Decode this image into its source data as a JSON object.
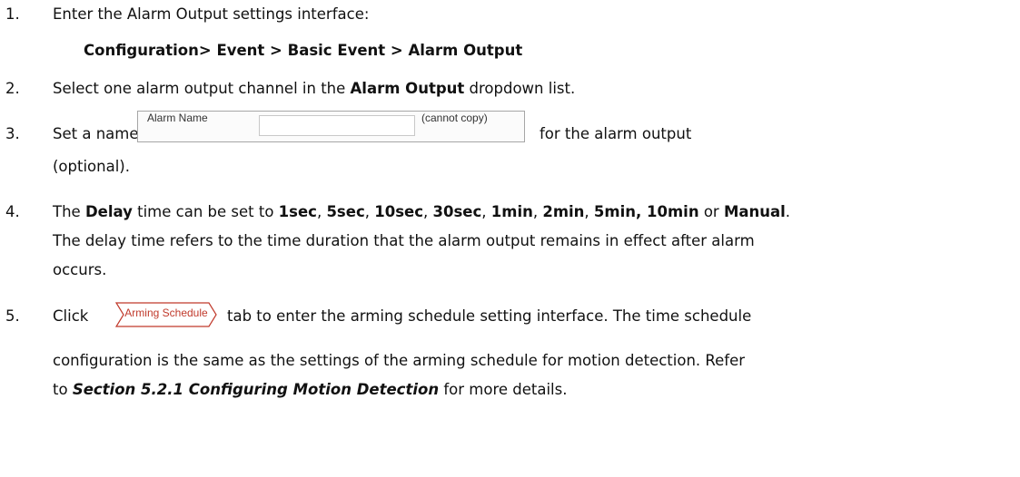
{
  "steps": [
    {
      "number": "1.",
      "lines": [
        "Enter the Alarm Output settings interface:",
        "Configuration> Event > Basic Event > Alarm Output"
      ]
    },
    {
      "number": "2.",
      "before": "Select one alarm output channel in the ",
      "bold": "Alarm Output",
      "after": " dropdown list."
    },
    {
      "number": "3.",
      "before": "Set a name in",
      "after": "for the alarm output",
      "continuation": "(optional).",
      "widget": {
        "label": "Alarm Name",
        "value": "",
        "hint": "(cannot copy)"
      }
    },
    {
      "number": "4.",
      "intro": "The ",
      "delay_word": "Delay",
      "mid": " time can be set to ",
      "options": [
        "1sec",
        "5sec",
        "10sec",
        "30sec",
        "1min",
        "2min",
        "5min, 10min"
      ],
      "or_text": " or ",
      "manual": "Manual",
      "end_period": ".",
      "explain_lines": [
        "The delay time refers to the time duration that the alarm output remains in effect after alarm",
        "occurs."
      ]
    },
    {
      "number": "5.",
      "before": "Click",
      "after": "tab to enter the arming schedule setting interface. The time schedule",
      "tab_label": "Arming Schedule",
      "line2": "configuration is the same as the settings of the arming schedule for motion detection. Refer",
      "line3_before": "to ",
      "line3_ref": "Section 5.2.1 Configuring Motion Detection",
      "line3_after": " for more details."
    }
  ]
}
